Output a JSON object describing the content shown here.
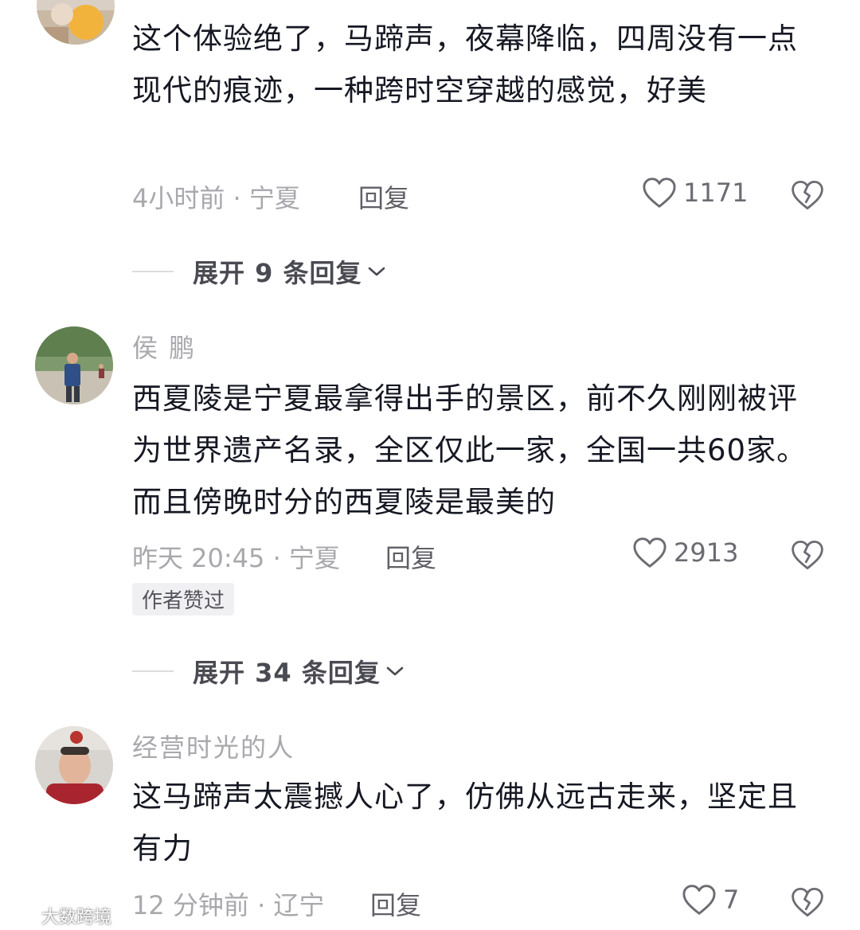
{
  "comments": [
    {
      "username": "",
      "text": "这个体验绝了，马蹄声，夜幕降临，四周没有一点现代的痕迹，一种跨时空穿越的感觉，好美",
      "meta": "4小时前 · 宁夏",
      "reply_label": "回复",
      "likes": "1171",
      "expand_label": "展开 9 条回复"
    },
    {
      "username": "侯 鹏",
      "text": "西夏陵是宁夏最拿得出手的景区，前不久刚刚被评为世界遗产名录，全区仅此一家，全国一共60家。而且傍晚时分的西夏陵是最美的",
      "meta": "昨天 20:45 · 宁夏",
      "reply_label": "回复",
      "likes": "2913",
      "badge": "作者赞过",
      "expand_label": "展开 34 条回复"
    },
    {
      "username": "经营时光的人",
      "text": "这马蹄声太震撼人心了，仿佛从远古走来，坚定且有力",
      "meta": "12 分钟前 · 辽宁",
      "reply_label": "回复",
      "likes": "7"
    }
  ],
  "icons": {
    "like": "heart-outline-icon",
    "dislike": "broken-heart-icon",
    "expand": "chevron-down-icon"
  },
  "watermark": {
    "text": "大数跨境"
  },
  "colors": {
    "text": "#161823",
    "secondary": "#a8a8ad",
    "reply": "#5f5f66",
    "badge_bg": "#f0f0f2"
  }
}
